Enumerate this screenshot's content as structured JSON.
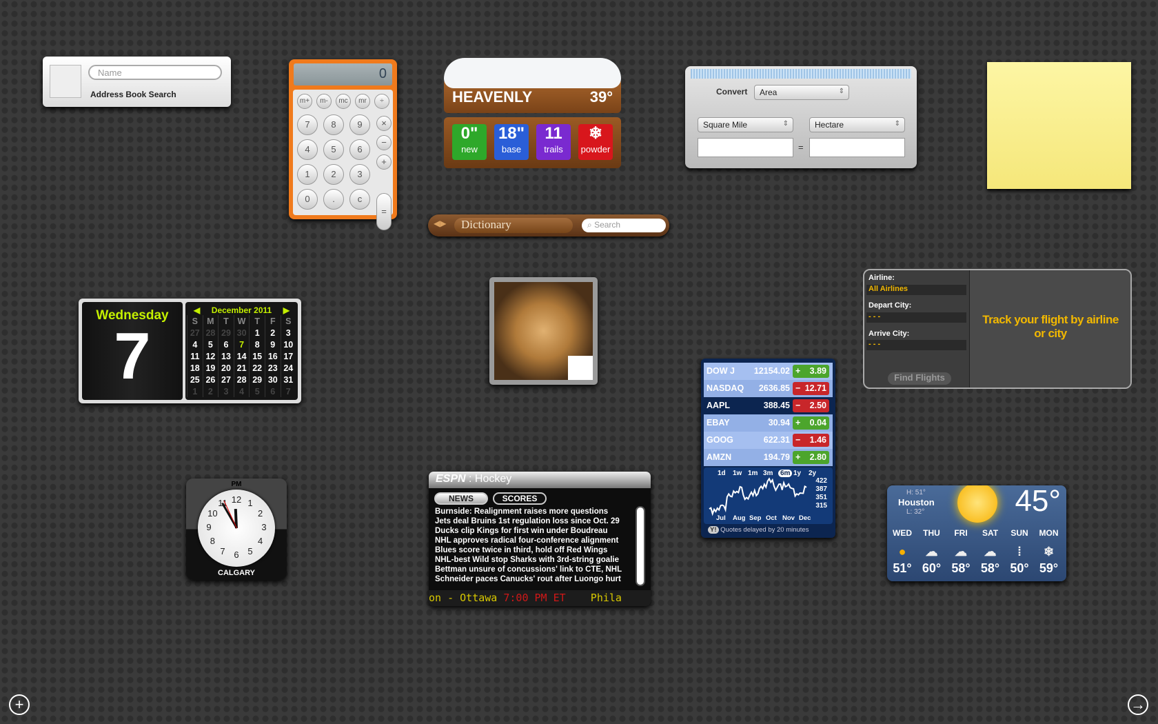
{
  "address_book": {
    "placeholder": "Name",
    "label": "Address Book Search"
  },
  "calculator": {
    "display": "0",
    "keys": [
      "m+",
      "m-",
      "mc",
      "mr",
      "÷",
      "7",
      "8",
      "9",
      "×",
      "4",
      "5",
      "6",
      "−",
      "1",
      "2",
      "3",
      "+",
      "0",
      ".",
      "c",
      "="
    ]
  },
  "ski": {
    "resort": "HEAVENLY",
    "temp": "39°",
    "stats": [
      {
        "value": "0\"",
        "label": "new",
        "color": "#2ea82a"
      },
      {
        "value": "18\"",
        "label": "base",
        "color": "#2a5ed8"
      },
      {
        "value": "11",
        "label": "trails",
        "color": "#7a2ad0"
      },
      {
        "value": "❄",
        "label": "powder",
        "color": "#d8161c"
      }
    ]
  },
  "unit_converter": {
    "convert_label": "Convert",
    "category": "Area",
    "from_unit": "Square Mile",
    "to_unit": "Hectare",
    "from_value": "",
    "to_value": "",
    "equals": "="
  },
  "dictionary": {
    "source": "Dictionary",
    "search_placeholder": "Search"
  },
  "calendar": {
    "weekday": "Wednesday",
    "day": "7",
    "month": "December 2011",
    "headers": [
      "S",
      "M",
      "T",
      "W",
      "T",
      "F",
      "S"
    ],
    "weeks": [
      [
        "27",
        "28",
        "29",
        "30",
        "1",
        "2",
        "3"
      ],
      [
        "4",
        "5",
        "6",
        "7",
        "8",
        "9",
        "10"
      ],
      [
        "11",
        "12",
        "13",
        "14",
        "15",
        "16",
        "17"
      ],
      [
        "18",
        "19",
        "20",
        "21",
        "22",
        "23",
        "24"
      ],
      [
        "25",
        "26",
        "27",
        "28",
        "29",
        "30",
        "31"
      ],
      [
        "1",
        "2",
        "3",
        "4",
        "5",
        "6",
        "7"
      ]
    ]
  },
  "flight": {
    "airline_label": "Airline:",
    "airline": "All Airlines",
    "depart_label": "Depart City:",
    "depart": "- - -",
    "arrive_label": "Arrive City:",
    "arrive": "- - -",
    "message": "Track your flight by airline or city",
    "button": "Find Flights",
    "accent": "#f2b800"
  },
  "stocks": {
    "rows": [
      {
        "symbol": "DOW J",
        "price": "12154.02",
        "sign": "+",
        "change": "3.89"
      },
      {
        "symbol": "NASDAQ",
        "price": "2636.85",
        "sign": "−",
        "change": "12.71"
      },
      {
        "symbol": "AAPL",
        "price": "388.45",
        "sign": "−",
        "change": "2.50",
        "selected": true
      },
      {
        "symbol": "EBAY",
        "price": "30.94",
        "sign": "+",
        "change": "0.04"
      },
      {
        "symbol": "GOOG",
        "price": "622.31",
        "sign": "−",
        "change": "1.46"
      },
      {
        "symbol": "AMZN",
        "price": "194.79",
        "sign": "+",
        "change": "2.80"
      }
    ],
    "ranges": [
      "1d",
      "1w",
      "1m",
      "3m",
      "6m",
      "1y",
      "2y"
    ],
    "selected_range": "6m",
    "y_ticks": [
      "422",
      "387",
      "351",
      "315"
    ],
    "x_ticks": [
      "Jul",
      "Aug",
      "Sep",
      "Oct",
      "Nov",
      "Dec"
    ],
    "footer": "Quotes delayed by 20 minutes",
    "up_color": "#4ca52c",
    "down_color": "#c8262a"
  },
  "clock": {
    "period": "PM",
    "city": "CALGARY",
    "time": "11:55"
  },
  "espn": {
    "sport": "Hockey",
    "tabs": [
      "NEWS",
      "SCORES"
    ],
    "headlines": [
      "Burnside: Realignment raises more questions",
      "Jets deal Bruins 1st regulation loss since Oct. 29",
      "Ducks clip Kings for first win under Boudreau",
      "NHL approves radical four-conference alignment",
      "Blues score twice in third, hold off Red Wings",
      "NHL-best Wild stop Sharks with 3rd-string goalie",
      "Bettman unsure of concussions' link to CTE, NHL",
      "Schneider paces Canucks' rout after Luongo hurt"
    ],
    "ticker": [
      "on - Ottawa ",
      "7:00 PM ET",
      "    Phila"
    ]
  },
  "weather": {
    "city": "Houston",
    "high": "H: 51°",
    "low": "L: 32°",
    "current": "45°",
    "forecast": [
      {
        "day": "WED",
        "icon": "sun",
        "temp": "51°"
      },
      {
        "day": "THU",
        "icon": "partly-cloudy",
        "temp": "60°"
      },
      {
        "day": "FRI",
        "icon": "partly-cloudy",
        "temp": "58°"
      },
      {
        "day": "SAT",
        "icon": "partly-cloudy",
        "temp": "58°"
      },
      {
        "day": "SUN",
        "icon": "rain",
        "temp": "50°"
      },
      {
        "day": "MON",
        "icon": "snow",
        "temp": "59°"
      }
    ]
  },
  "dashboard": {
    "add_icon": "plus-circle-icon",
    "exit_icon": "arrow-right-circle-icon"
  }
}
